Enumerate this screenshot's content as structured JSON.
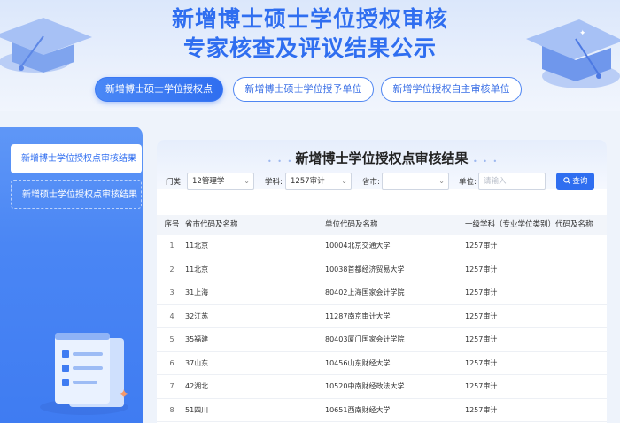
{
  "header": {
    "title_line1": "新增博士硕士学位授权审核",
    "title_line2": "专家核查及评议结果公示"
  },
  "tabs": [
    {
      "label": "新增博士硕士学位授权点",
      "active": true
    },
    {
      "label": "新增博士硕士学位授予单位",
      "active": false
    },
    {
      "label": "新增学位授权自主审核单位",
      "active": false
    }
  ],
  "sidebar": {
    "items": [
      {
        "label": "新增博士学位授权点审核结果",
        "active": true
      },
      {
        "label": "新增硕士学位授权点审核结果",
        "active": false
      }
    ],
    "active_arrow": "›"
  },
  "panel": {
    "title": "新增博士学位授权点审核结果",
    "dots": "• • •"
  },
  "filters": {
    "category_label": "门类:",
    "category_value": "12管理学",
    "discipline_label": "学科:",
    "discipline_value": "1257审计",
    "province_label": "省市:",
    "province_value": "",
    "unit_label": "单位:",
    "unit_placeholder": "请输入",
    "search_label": "查询",
    "dropdown_arrow": "⌄"
  },
  "table": {
    "headers": [
      "序号",
      "省市代码及名称",
      "单位代码及名称",
      "一级学科（专业学位类别）代码及名称"
    ],
    "rows": [
      [
        "1",
        "11北京",
        "10004北京交通大学",
        "1257审计"
      ],
      [
        "2",
        "11北京",
        "10038首都经济贸易大学",
        "1257审计"
      ],
      [
        "3",
        "31上海",
        "80402上海国家会计学院",
        "1257审计"
      ],
      [
        "4",
        "32江苏",
        "11287南京审计大学",
        "1257审计"
      ],
      [
        "5",
        "35福建",
        "80403厦门国家会计学院",
        "1257审计"
      ],
      [
        "6",
        "37山东",
        "10456山东财经大学",
        "1257审计"
      ],
      [
        "7",
        "42湖北",
        "10520中南财经政法大学",
        "1257审计"
      ],
      [
        "8",
        "51四川",
        "10651西南财经大学",
        "1257审计"
      ]
    ]
  },
  "colors": {
    "brand_blue": "#2f6ef0",
    "sidebar_blue": "#4a86f4",
    "page_bg": "#eef3fb"
  }
}
